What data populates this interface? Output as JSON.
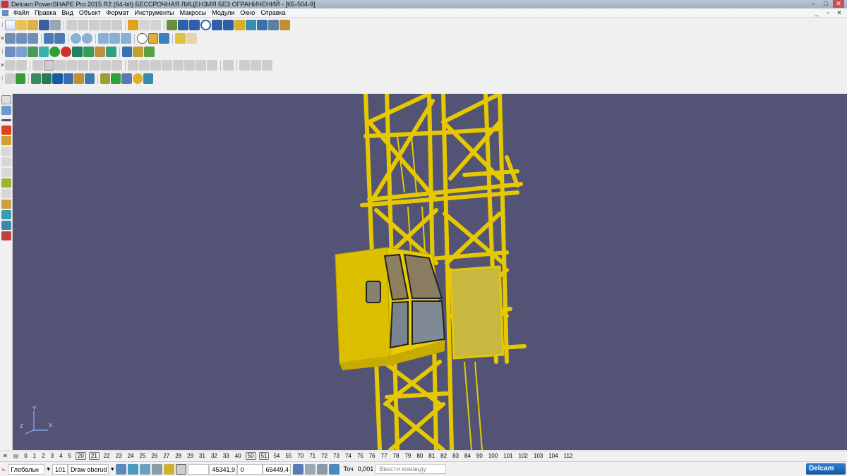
{
  "window": {
    "title": "Delcam PowerSHAPE Pro 2015 R2 (64-bit) БЕССРОЧНАЯ ЛИЦЕНЗИЯ БЕЗ ОГРАНИЧЕНИЙ - [КБ-504-9]",
    "minimize": "–",
    "maximize": "□",
    "close": "✕",
    "mdi_minimize": "_",
    "mdi_restore": "▫",
    "mdi_close": "✕"
  },
  "menu": [
    "Файл",
    "Правка",
    "Вид",
    "Объект",
    "Формат",
    "Инструменты",
    "Макросы",
    "Модули",
    "Окно",
    "Справка"
  ],
  "toolbars": {
    "row1_grip": "⁝",
    "row2_grip": "✕",
    "row3_grip": "⁝",
    "row4_grip": "✕",
    "row5_grip": "⁝"
  },
  "viewport": {
    "background": "#535375",
    "structure_color": "#e6c800",
    "axis_labels": {
      "x": "X",
      "y": "Y",
      "z": "Z"
    }
  },
  "levels": {
    "visible": [
      "0",
      "1",
      "2",
      "3",
      "4",
      "5",
      "20",
      "21",
      "22",
      "23",
      "24",
      "25",
      "26",
      "27",
      "28",
      "29",
      "31",
      "32",
      "33",
      "40",
      "50",
      "51",
      "54",
      "55",
      "70",
      "71",
      "72",
      "73",
      "74",
      "75",
      "76",
      "77",
      "78",
      "79",
      "80",
      "81",
      "82",
      "83",
      "84",
      "90",
      "100",
      "101",
      "102",
      "103",
      "104",
      "112"
    ],
    "boxed": [
      "20",
      "21",
      "50",
      "51"
    ]
  },
  "status": {
    "workplane": "Глобальн",
    "level": "101",
    "level_name": "Draw oborud",
    "coord_x": "45341,9",
    "coord_y": "0",
    "coord_z": "65449,4",
    "tolerance_label": "Точ",
    "tolerance_value": "0,001",
    "command_placeholder": "Ввести команду",
    "brand": "Delcam"
  }
}
